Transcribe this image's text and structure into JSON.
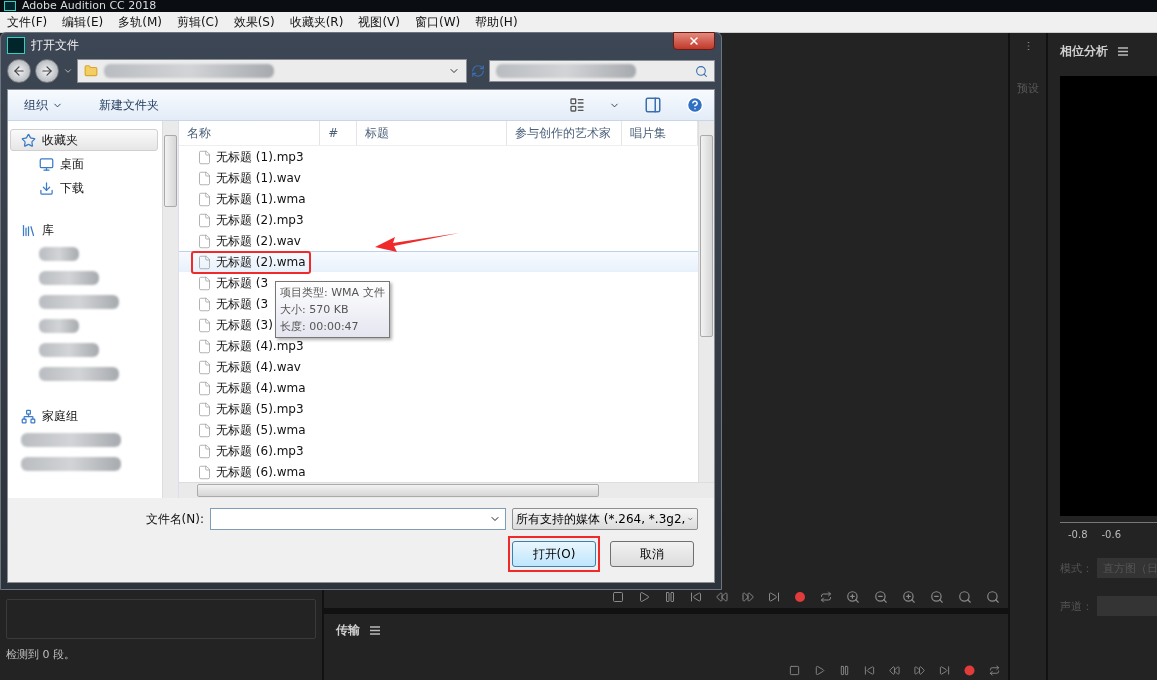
{
  "app": {
    "title": "Adobe Audition CC 2018",
    "menu": [
      "文件(F)",
      "编辑(E)",
      "多轨(M)",
      "剪辑(C)",
      "效果(S)",
      "收藏夹(R)",
      "视图(V)",
      "窗口(W)",
      "帮助(H)"
    ]
  },
  "dialog": {
    "title": "打开文件",
    "organize": "组织",
    "new_folder": "新建文件夹",
    "nav": [
      {
        "label": "收藏夹",
        "selected": true,
        "children": [
          {
            "label": "桌面",
            "selected": false
          },
          {
            "label": "下载",
            "selected": false
          }
        ]
      },
      {
        "label": "库",
        "selected": false
      },
      {
        "label": "家庭组",
        "selected": false
      }
    ],
    "columns": [
      "名称",
      "#",
      "标题",
      "参与创作的艺术家",
      "唱片集"
    ],
    "files": [
      {
        "name": "无标题 (1).mp3",
        "selected": false,
        "annotated": false
      },
      {
        "name": "无标题 (1).wav",
        "selected": false,
        "annotated": false
      },
      {
        "name": "无标题 (1).wma",
        "selected": false,
        "annotated": false
      },
      {
        "name": "无标题 (2).mp3",
        "selected": false,
        "annotated": false
      },
      {
        "name": "无标题 (2).wav",
        "selected": false,
        "annotated": false
      },
      {
        "name": "无标题 (2).wma",
        "selected": true,
        "annotated": true
      },
      {
        "name": "无标题 (3",
        "selected": false,
        "annotated": false
      },
      {
        "name": "无标题 (3",
        "selected": false,
        "annotated": false
      },
      {
        "name": "无标题 (3)",
        "selected": false,
        "annotated": false
      },
      {
        "name": "无标题 (4).mp3",
        "selected": false,
        "annotated": false
      },
      {
        "name": "无标题 (4).wav",
        "selected": false,
        "annotated": false
      },
      {
        "name": "无标题 (4).wma",
        "selected": false,
        "annotated": false
      },
      {
        "name": "无标题 (5).mp3",
        "selected": false,
        "annotated": false
      },
      {
        "name": "无标题 (5).wma",
        "selected": false,
        "annotated": false
      },
      {
        "name": "无标题 (6).mp3",
        "selected": false,
        "annotated": false
      },
      {
        "name": "无标题 (6).wma",
        "selected": false,
        "annotated": false
      }
    ],
    "tooltip": [
      "项目类型: WMA 文件",
      "大小: 570 KB",
      "长度: 00:00:47"
    ],
    "filename_label": "文件名(N):",
    "filter": "所有支持的媒体 (*.264, *.3g2,",
    "buttons": [
      {
        "label": "打开(O)",
        "kind": "primary",
        "annotated": true
      },
      {
        "label": "取消",
        "kind": "normal",
        "annotated": false
      }
    ]
  },
  "left_panel": {
    "status": "检测到 0 段。"
  },
  "side_tab": "预设",
  "transport": {
    "title": "传输"
  },
  "phase": {
    "title": "相位分析",
    "ticks": [
      "-0.8",
      "-0.6"
    ],
    "mode_label": "模式：",
    "mode_value": "直方图（日",
    "channel_label": "声道："
  }
}
